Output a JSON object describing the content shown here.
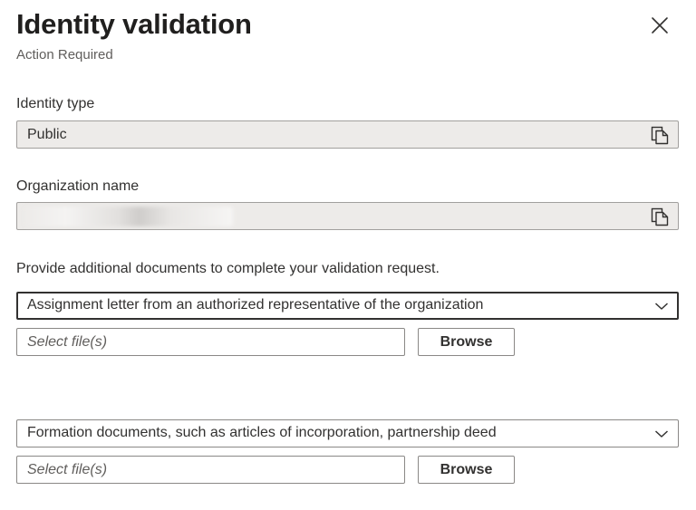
{
  "header": {
    "title": "Identity validation",
    "subtitle": "Action Required",
    "close_icon": "close-icon"
  },
  "identity_type": {
    "label": "Identity type",
    "value": "Public",
    "copy_icon": "copy-icon"
  },
  "organization_name": {
    "label": "Organization name",
    "value": "",
    "copy_icon": "copy-icon"
  },
  "documents": {
    "instruction": "Provide additional documents to complete your validation request.",
    "items": [
      {
        "document_type": "Assignment letter from an authorized representative of the organization",
        "file_placeholder": "Select file(s)",
        "browse_label": "Browse"
      },
      {
        "document_type": "Formation documents, such as articles of incorporation, partnership deed",
        "file_placeholder": "Select file(s)",
        "browse_label": "Browse"
      }
    ]
  },
  "colors": {
    "field_background": "#edebe9",
    "border": "#8a8886",
    "focused_border": "#323130",
    "text": "#323130",
    "secondary_text": "#605e5c"
  }
}
